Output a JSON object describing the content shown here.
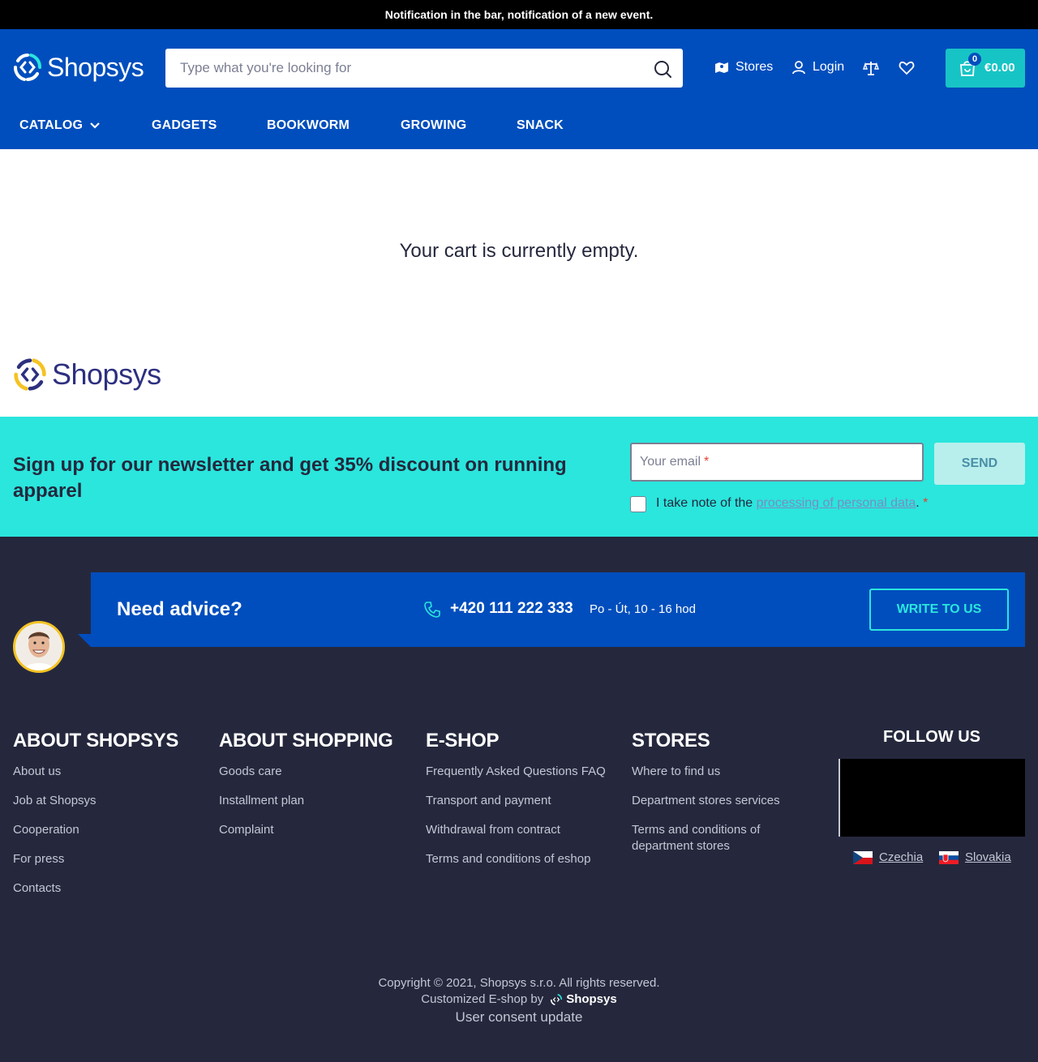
{
  "notification": "Notification in the bar, notification of a new event.",
  "brand": {
    "name": "Shopsys"
  },
  "search": {
    "placeholder": "Type what you're looking for"
  },
  "header_links": {
    "stores": "Stores",
    "login": "Login"
  },
  "cart": {
    "count": "0",
    "price": "€0.00"
  },
  "nav": [
    "CATALOG",
    "GADGETS",
    "BOOKWORM",
    "GROWING",
    "SNACK"
  ],
  "empty_cart": "Your cart is currently empty.",
  "newsletter": {
    "title": "Sign up for our newsletter and get 35% discount on running apparel",
    "email_placeholder": "Your email",
    "required_mark": "*",
    "send_label": "SEND",
    "consent_prefix": "I take note of the",
    "consent_link": "processing of personal data",
    "consent_suffix": "."
  },
  "advice": {
    "title": "Need advice?",
    "phone": "+420 111 222 333",
    "hours": "Po - Út, 10 - 16 hod",
    "write_label": "WRITE TO US"
  },
  "footer_columns": [
    {
      "title": "ABOUT SHOPSYS",
      "links": [
        "About us",
        "Job at Shopsys",
        "Cooperation",
        "For press",
        "Contacts"
      ]
    },
    {
      "title": "ABOUT SHOPPING",
      "links": [
        "Goods care",
        "Installment plan",
        "Complaint"
      ]
    },
    {
      "title": "E-SHOP",
      "links": [
        "Frequently Asked Questions FAQ",
        "Transport and payment",
        "Withdrawal from contract",
        "Terms and conditions of eshop"
      ]
    },
    {
      "title": "STORES",
      "links": [
        "Where to find us",
        "Department stores services",
        "Terms and conditions of department stores"
      ]
    }
  ],
  "follow_us": "FOLLOW US",
  "countries": [
    "Czechia",
    "Slovakia"
  ],
  "copyright": "Copyright © 2021, Shopsys s.r.o. All rights reserved.",
  "built_by": "Customized E-shop by",
  "consent_update": "User consent update",
  "colors": {
    "primary": "#004ebd",
    "accent": "#17c4c5",
    "newsletter_bg": "#2ae6dd",
    "footer_bg": "#25283d"
  }
}
